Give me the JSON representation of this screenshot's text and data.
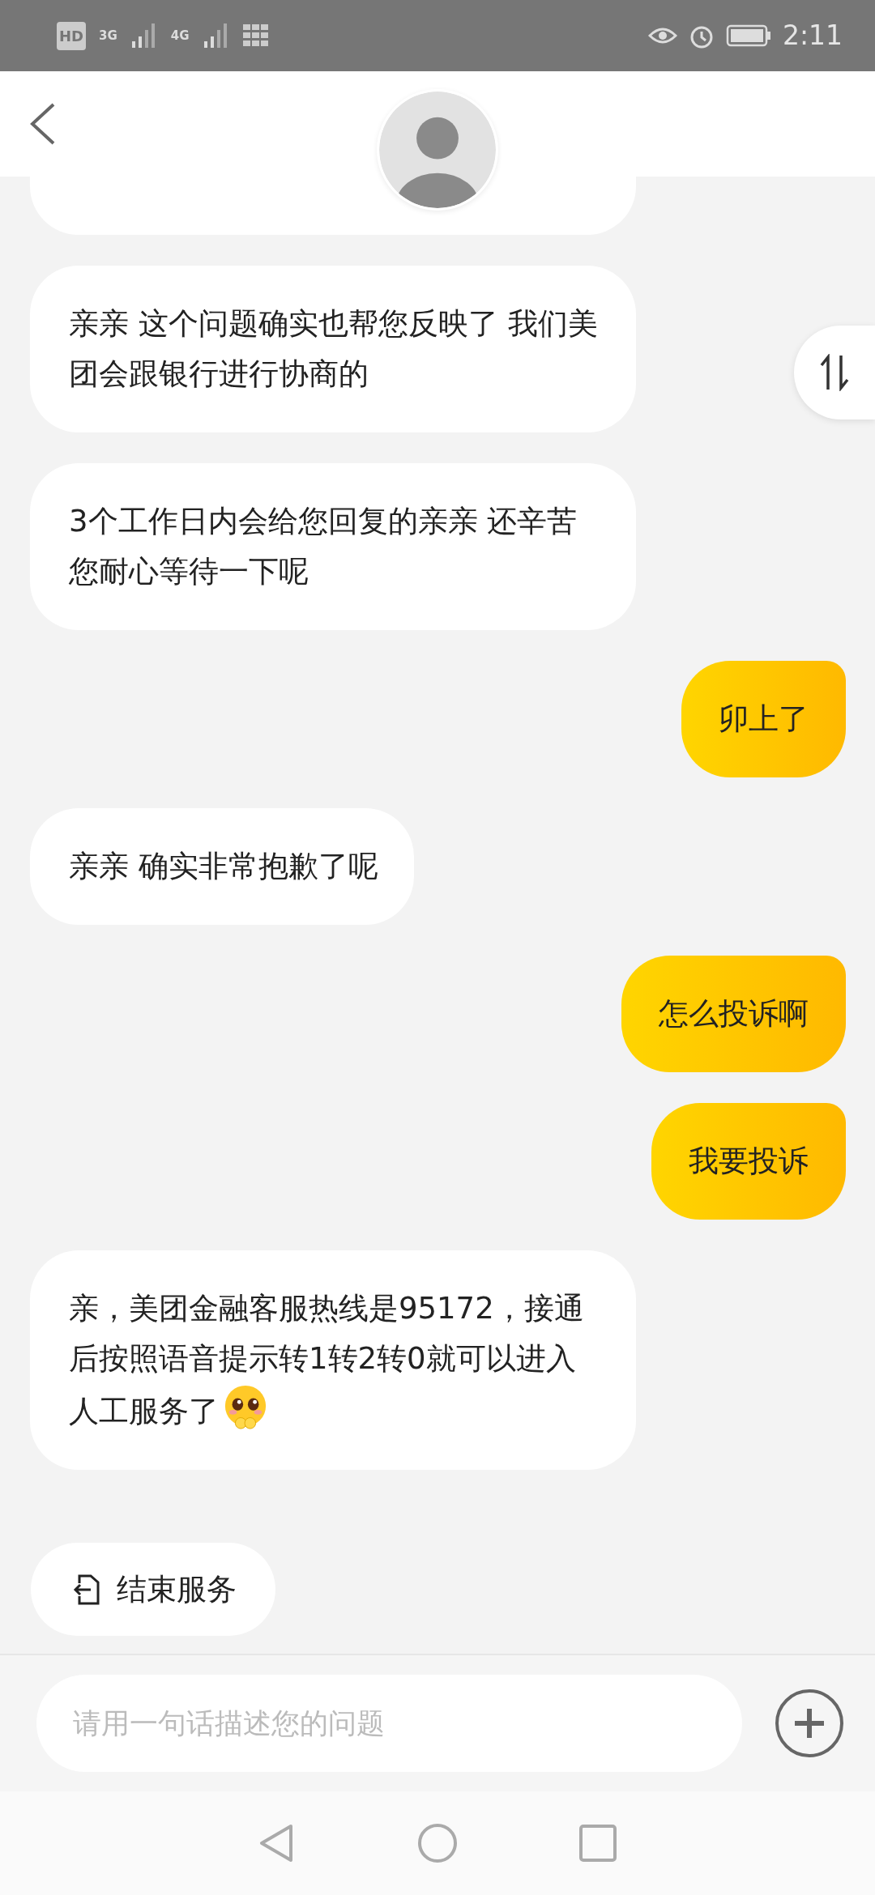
{
  "status_bar": {
    "network_labels": [
      "HD",
      "3G",
      "4G"
    ],
    "time": "2:11"
  },
  "messages": [
    {
      "kind": "agent",
      "text": "亲亲 这个问题确实也帮您反映了 我们美团会跟银行进行协商的",
      "has_emoji": false
    },
    {
      "kind": "agent",
      "text": "3个工作日内会给您回复的亲亲 还辛苦您耐心等待一下呢",
      "has_emoji": false
    },
    {
      "kind": "user",
      "text": "卯上了",
      "has_emoji": false
    },
    {
      "kind": "agent",
      "text": "亲亲 确实非常抱歉了呢",
      "has_emoji": false
    },
    {
      "kind": "user",
      "text": "怎么投诉啊",
      "has_emoji": false
    },
    {
      "kind": "user",
      "text": "我要投诉",
      "has_emoji": false
    },
    {
      "kind": "agent",
      "text": "亲，美团金融客服热线是95172，接通后按照语音提示转1转2转0就可以进入人工服务了",
      "has_emoji": true
    }
  ],
  "quick_actions": [
    {
      "label": "结束服务"
    }
  ],
  "composer": {
    "placeholder": "请用一句话描述您的问题"
  }
}
